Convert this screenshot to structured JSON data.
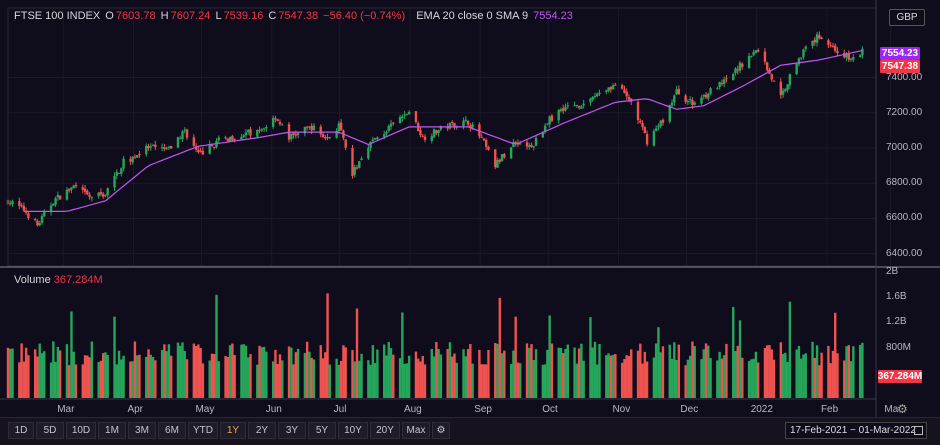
{
  "legend": {
    "symbol": "FTSE 100 INDEX",
    "o_label": "O",
    "o_value": "7603.78",
    "h_label": "H",
    "h_value": "7607.24",
    "l_label": "L",
    "l_value": "7539.16",
    "c_label": "C",
    "c_value": "7547.38",
    "change": "−56.40 (−0.74%)",
    "indicators_label": "EMA 20 close 0 SMA 9",
    "indicator_value": "7554.23"
  },
  "volume_legend": {
    "label": "Volume",
    "value": "367.284M"
  },
  "currency": "GBP",
  "price_tags": {
    "ema": "7554.23",
    "close": "7547.38"
  },
  "volume_tag": "367.284M",
  "colors": {
    "up": "#26a65b",
    "down": "#ef5350",
    "ema": "#c257f4",
    "background": "#0f0c1b",
    "tag_ema": "#9c27f5",
    "tag_close": "#f23645",
    "active_range": "#f2a63a"
  },
  "ranges": [
    "1D",
    "5D",
    "10D",
    "1M",
    "3M",
    "6M",
    "YTD",
    "1Y",
    "2Y",
    "3Y",
    "5Y",
    "10Y",
    "20Y",
    "Max"
  ],
  "active_range": "1Y",
  "settings_icon": "gear-icon",
  "date_range": "17-Feb-2021 − 01-Mar-2022",
  "chart_data": {
    "type": "candlestick",
    "title": "FTSE 100 INDEX",
    "x_ticks": [
      "Mar",
      "Apr",
      "May",
      "Jun",
      "Jul",
      "Aug",
      "Sep",
      "Oct",
      "Nov",
      "Dec",
      "2022",
      "Feb",
      "Ma"
    ],
    "y_ticks": [
      6400,
      6600,
      6800,
      7000,
      7200,
      7400
    ],
    "ylim": [
      6330,
      7670
    ],
    "volume_ticks": [
      "2B",
      "1.6B",
      "1.2B",
      "800M"
    ],
    "volume_ylim": [
      0,
      2000
    ],
    "volume_unit": "M",
    "price_anchors": [
      {
        "date": "2021-02-17",
        "value": 6700
      },
      {
        "date": "2021-02-24",
        "value": 6650
      },
      {
        "date": "2021-03-02",
        "value": 6560
      },
      {
        "date": "2021-03-09",
        "value": 6700
      },
      {
        "date": "2021-03-18",
        "value": 6780
      },
      {
        "date": "2021-03-25",
        "value": 6720
      },
      {
        "date": "2021-04-01",
        "value": 6740
      },
      {
        "date": "2021-04-09",
        "value": 6920
      },
      {
        "date": "2021-04-20",
        "value": 7000
      },
      {
        "date": "2021-04-29",
        "value": 6990
      },
      {
        "date": "2021-05-06",
        "value": 7100
      },
      {
        "date": "2021-05-12",
        "value": 6960
      },
      {
        "date": "2021-05-21",
        "value": 7040
      },
      {
        "date": "2021-06-01",
        "value": 7080
      },
      {
        "date": "2021-06-08",
        "value": 7090
      },
      {
        "date": "2021-06-15",
        "value": 7180
      },
      {
        "date": "2021-06-21",
        "value": 7060
      },
      {
        "date": "2021-07-01",
        "value": 7120
      },
      {
        "date": "2021-07-08",
        "value": 7050
      },
      {
        "date": "2021-07-13",
        "value": 7130
      },
      {
        "date": "2021-07-19",
        "value": 6850
      },
      {
        "date": "2021-07-26",
        "value": 7020
      },
      {
        "date": "2021-08-04",
        "value": 7110
      },
      {
        "date": "2021-08-13",
        "value": 7210
      },
      {
        "date": "2021-08-19",
        "value": 7060
      },
      {
        "date": "2021-08-31",
        "value": 7130
      },
      {
        "date": "2021-09-08",
        "value": 7150
      },
      {
        "date": "2021-09-14",
        "value": 7050
      },
      {
        "date": "2021-09-20",
        "value": 6900
      },
      {
        "date": "2021-09-29",
        "value": 7040
      },
      {
        "date": "2021-10-06",
        "value": 7000
      },
      {
        "date": "2021-10-13",
        "value": 7150
      },
      {
        "date": "2021-10-20",
        "value": 7230
      },
      {
        "date": "2021-10-29",
        "value": 7250
      },
      {
        "date": "2021-11-05",
        "value": 7320
      },
      {
        "date": "2021-11-12",
        "value": 7360
      },
      {
        "date": "2021-11-19",
        "value": 7260
      },
      {
        "date": "2021-11-26",
        "value": 7040
      },
      {
        "date": "2021-12-03",
        "value": 7160
      },
      {
        "date": "2021-12-09",
        "value": 7320
      },
      {
        "date": "2021-12-16",
        "value": 7250
      },
      {
        "date": "2021-12-21",
        "value": 7300
      },
      {
        "date": "2021-12-31",
        "value": 7380
      },
      {
        "date": "2022-01-07",
        "value": 7480
      },
      {
        "date": "2022-01-14",
        "value": 7560
      },
      {
        "date": "2022-01-24",
        "value": 7290
      },
      {
        "date": "2022-02-01",
        "value": 7520
      },
      {
        "date": "2022-02-10",
        "value": 7640
      },
      {
        "date": "2022-02-17",
        "value": 7560
      },
      {
        "date": "2022-02-24",
        "value": 7500
      },
      {
        "date": "2022-03-01",
        "value": 7547
      }
    ],
    "ema_anchors": [
      {
        "date": "2021-02-24",
        "value": 6640
      },
      {
        "date": "2021-03-15",
        "value": 6640
      },
      {
        "date": "2021-04-01",
        "value": 6700
      },
      {
        "date": "2021-04-20",
        "value": 6900
      },
      {
        "date": "2021-05-12",
        "value": 7010
      },
      {
        "date": "2021-06-08",
        "value": 7060
      },
      {
        "date": "2021-06-21",
        "value": 7090
      },
      {
        "date": "2021-07-13",
        "value": 7090
      },
      {
        "date": "2021-07-26",
        "value": 7020
      },
      {
        "date": "2021-08-13",
        "value": 7120
      },
      {
        "date": "2021-09-08",
        "value": 7120
      },
      {
        "date": "2021-09-29",
        "value": 7020
      },
      {
        "date": "2021-10-20",
        "value": 7140
      },
      {
        "date": "2021-11-12",
        "value": 7260
      },
      {
        "date": "2021-11-26",
        "value": 7280
      },
      {
        "date": "2021-12-09",
        "value": 7220
      },
      {
        "date": "2021-12-21",
        "value": 7240
      },
      {
        "date": "2022-01-07",
        "value": 7350
      },
      {
        "date": "2022-01-24",
        "value": 7470
      },
      {
        "date": "2022-02-10",
        "value": 7500
      },
      {
        "date": "2022-03-01",
        "value": 7554
      }
    ]
  }
}
